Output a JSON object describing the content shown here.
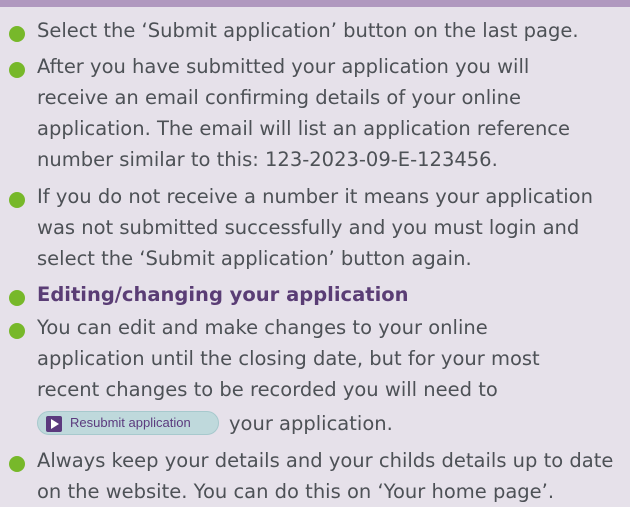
{
  "items": [
    {
      "lines": [
        "Select the ‘Submit application’ button on the last page."
      ]
    },
    {
      "lines": [
        "After you have submitted your application you will",
        "receive an email confirming details of your online",
        "application. The email will list an application reference",
        "number similar to this: 123-2023-09-E-123456."
      ]
    },
    {
      "lines": [
        "If you do not receive a number it means your application",
        "was not submitted successfully and you must login and",
        "select the ‘Submit application’ button again."
      ]
    },
    {
      "heading": "Editing/changing your application"
    },
    {
      "lines": [
        "You can edit and make changes to your online",
        "application until the closing date, but for your most",
        "recent changes to be recorded you will need to"
      ],
      "button_label": "Resubmit application",
      "after_button": "your application."
    },
    {
      "lines": [
        "Always keep your details and your childs details up to date",
        "on the website. You can do this on ‘Your home page’."
      ]
    }
  ],
  "colors": {
    "bullet": "#77b82a",
    "heading": "#5a3d75",
    "background": "#e6e1ea",
    "accent_strip": "#b098bf"
  }
}
